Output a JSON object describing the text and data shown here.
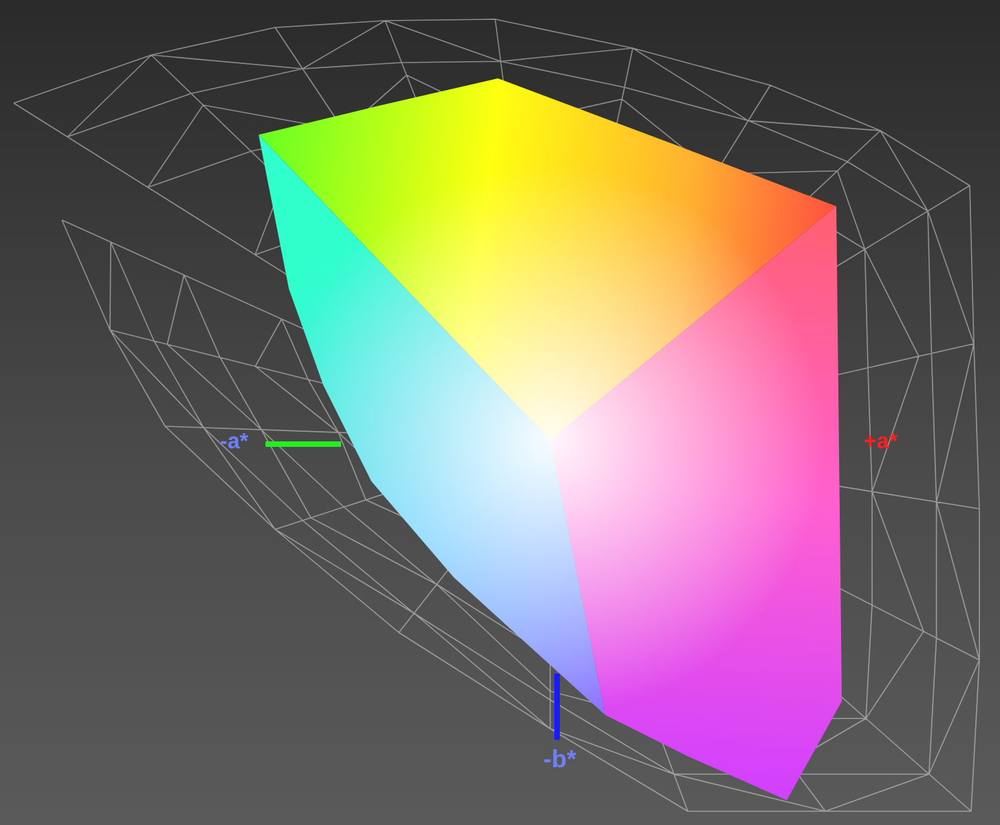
{
  "axis_labels": [
    {
      "text": "-a*",
      "kind": "neg_a"
    },
    {
      "text": "+a*",
      "kind": "pos_a"
    },
    {
      "text": "-b*",
      "kind": "neg_b"
    }
  ]
}
